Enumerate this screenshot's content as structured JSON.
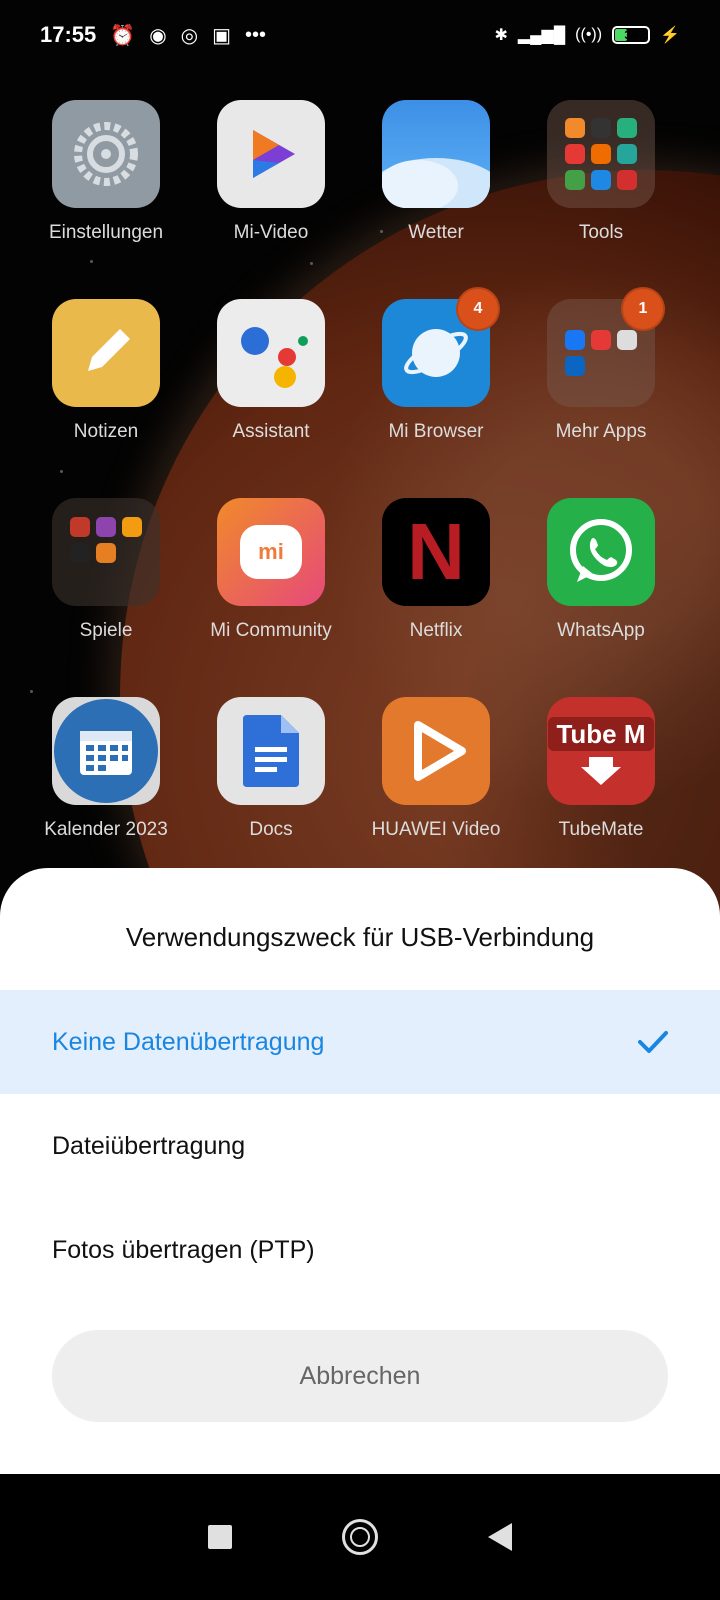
{
  "status_bar": {
    "time": "17:55",
    "battery": "34",
    "icons": [
      "alarm-icon",
      "notification-icon",
      "chrome-icon",
      "instagram-icon",
      "more-icon",
      "bluetooth-icon",
      "signal-icon",
      "wifi-icon",
      "battery-icon",
      "charging-icon"
    ]
  },
  "apps": [
    {
      "label": "Einstellungen",
      "icon": "settings-gear-icon"
    },
    {
      "label": "Mi-Video",
      "icon": "play-icon"
    },
    {
      "label": "Wetter",
      "icon": "weather-cloud-icon"
    },
    {
      "label": "Tools",
      "icon": "folder-icon"
    },
    {
      "label": "Notizen",
      "icon": "pencil-icon"
    },
    {
      "label": "Assistant",
      "icon": "assistant-dots-icon"
    },
    {
      "label": "Mi Browser",
      "icon": "browser-planet-icon",
      "badge": "4"
    },
    {
      "label": "Mehr Apps",
      "icon": "folder-icon",
      "badge": "1"
    },
    {
      "label": "Spiele",
      "icon": "folder-icon"
    },
    {
      "label": "Mi Community",
      "icon": "mi-community-icon",
      "text": "mi"
    },
    {
      "label": "Netflix",
      "icon": "netflix-icon",
      "text": "N"
    },
    {
      "label": "WhatsApp",
      "icon": "whatsapp-icon"
    },
    {
      "label": "Kalender 2023",
      "icon": "calendar-icon"
    },
    {
      "label": "Docs",
      "icon": "docs-icon"
    },
    {
      "label": "HUAWEI Video",
      "icon": "huawei-video-icon"
    },
    {
      "label": "TubeMate",
      "icon": "tubemate-icon",
      "text": "Tube M"
    }
  ],
  "dialog": {
    "title": "Verwendungszweck für USB-Verbindung",
    "options": [
      {
        "label": "Keine Datenübertragung",
        "selected": true
      },
      {
        "label": "Dateiübertragung",
        "selected": false
      },
      {
        "label": "Fotos übertragen (PTP)",
        "selected": false
      }
    ],
    "cancel_label": "Abbrechen",
    "accent_color": "#1a86e0",
    "selected_bg": "#e3effc"
  },
  "nav_bar": {
    "buttons": [
      "recents-icon",
      "home-icon",
      "back-icon"
    ]
  }
}
